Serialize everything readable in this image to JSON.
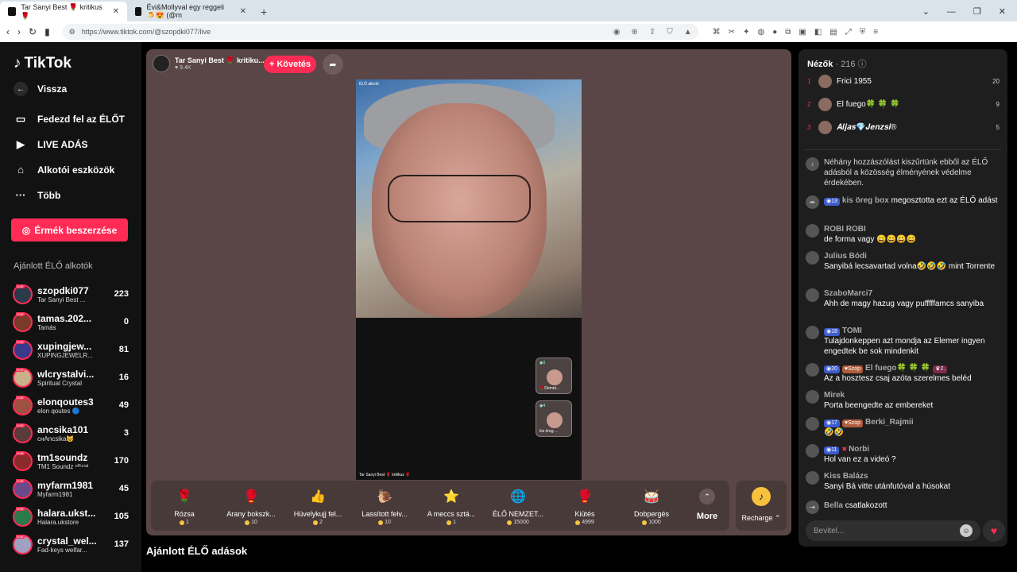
{
  "browser": {
    "tabs": [
      {
        "title": "Tar Sanyi Best 🌹 kritikus 🌹"
      },
      {
        "title": "Évi&Mollyval egy reggeli 🍮😍 (@m"
      }
    ],
    "url": "https://www.tiktok.com/@szopdki077/live"
  },
  "sidebar": {
    "logo": "TikTok",
    "back": "Vissza",
    "nav": [
      {
        "label": "Fedezd fel az ÉLŐT",
        "icon": "explore-live-icon"
      },
      {
        "label": "LIVE ADÁS",
        "icon": "camera-icon"
      },
      {
        "label": "Alkotói eszközök",
        "icon": "house-icon"
      },
      {
        "label": "Több",
        "icon": "more-dots-icon"
      }
    ],
    "coins_button": "Érmék beszerzése",
    "recommended_title": "Ajánlott ÉLŐ alkotók",
    "creators": [
      {
        "name": "szopdki077",
        "sub": "Tar Sanyi Best ...",
        "count": "223",
        "color": "#2b3a4a"
      },
      {
        "name": "tamas.202...",
        "sub": "Tamás",
        "count": "0",
        "color": "#7a3a2a"
      },
      {
        "name": "xupingjew...",
        "sub": "XUPINGJEWELR...",
        "count": "81",
        "color": "#3a3a8a"
      },
      {
        "name": "wlcrystalvi...",
        "sub": "Spiritual Crystal",
        "count": "16",
        "color": "#c9b089"
      },
      {
        "name": "elonqoutes3",
        "sub": "elon qoutes 🔵",
        "count": "49",
        "color": "#a05040"
      },
      {
        "name": "ancsika101",
        "sub": "ᴄнAncsika😺",
        "count": "3",
        "color": "#5a3a3a"
      },
      {
        "name": "tm1soundz",
        "sub": "TM1 Soundz ᵒᶠᶠⁱᶜⁱᵃˡ",
        "count": "170",
        "color": "#8a2a2a"
      },
      {
        "name": "myfarm1981",
        "sub": "Myfarm1981",
        "count": "45",
        "color": "#6a4a8a"
      },
      {
        "name": "halara.ukst...",
        "sub": "Halara.ukstore",
        "count": "105",
        "color": "#2a7a4a"
      },
      {
        "name": "crystal_wel...",
        "sub": "Fad-keys welfar...",
        "count": "137",
        "color": "#a0a0c0"
      }
    ]
  },
  "stream": {
    "host_name": "Tar Sanyi Best 🌹 kritiku...",
    "likes": "♥ 9.4K",
    "follow_button": "+ Követés",
    "video_top_text": "ÉLŐ alkotó",
    "video_bottom_text": "Tar Sanyi Best 🌹 kritikus 🌹",
    "cohosts": [
      {
        "count": "◉0",
        "label": "🌹Demet..."
      },
      {
        "count": "◉4",
        "label": "kis öreg ..."
      }
    ],
    "gifts": [
      {
        "name": "Rózsa",
        "price": "1",
        "icon": "🌹"
      },
      {
        "name": "Arany bokszk...",
        "price": "10",
        "icon": "🥊"
      },
      {
        "name": "Hüvelykujj fel...",
        "price": "2",
        "icon": "👍"
      },
      {
        "name": "Lassított felv...",
        "price": "10",
        "icon": "🐌"
      },
      {
        "name": "A meccs sztá...",
        "price": "1",
        "icon": "⭐"
      },
      {
        "name": "ÉLŐ NEMZET...",
        "price": "15000",
        "icon": "🌐"
      },
      {
        "name": "Kiütés",
        "price": "4999",
        "icon": "🥊"
      },
      {
        "name": "Dobpergés",
        "price": "1000",
        "icon": "🥁"
      }
    ],
    "more_label": "More",
    "recharge_label": "Recharge ⌃",
    "bottom_title": "Ajánlott ÉLŐ adások"
  },
  "chat": {
    "viewers_label": "Nézők",
    "viewers_count": "· 216",
    "top": [
      {
        "rank": "1",
        "name": "Frici 1955",
        "score": "20"
      },
      {
        "rank": "2",
        "name": "El fuego🍀 🍀 🍀",
        "score": "9"
      },
      {
        "rank": "3",
        "name": "𝑨𝒍𝒋𝒂𝒔💎𝑱𝒆𝒏𝒛𝒔𝒊®",
        "score": "5"
      }
    ],
    "messages": [
      {
        "user": "",
        "text": "Néhány hozzászólást kiszűrtünk ebből az ÉLŐ adásból a közösség élményének védelme érdekében.",
        "badges": []
      },
      {
        "user": "kis öreg box",
        "text": "megosztotta ezt az ÉLŐ adást",
        "badges": [
          "◉13"
        ]
      },
      {
        "user": "ROBI ROBI",
        "text": "de forma vagy 😄😄😄😄",
        "badges": []
      },
      {
        "user": "Julius Bódi",
        "text": "Sanyibá lecsavartad volna🤣🤣🤣 mint Torrente",
        "badges": []
      },
      {
        "user": "SzaboMarci7",
        "text": "Ahh de magy hazug vagy pufffffamcs sanyiba",
        "badges": []
      },
      {
        "user": "TOMI",
        "text": "Tulajdonkeppen azt mondja az Elemer ingyen engedtek be sok mindenkit",
        "badges": [
          "◉18"
        ]
      },
      {
        "user": "El fuego🍀 🍀 🍀",
        "text": "Az a hosztesz csaj azóta szerelmes beléd",
        "badges": [
          "◉20",
          "♥Szop",
          "♛2."
        ]
      },
      {
        "user": "Mirek",
        "text": "Porta beengedte az embereket",
        "badges": []
      },
      {
        "user": "Berki_Rajmii",
        "text": "🤣🤣",
        "badges": [
          "◉17",
          "♥Szop"
        ]
      },
      {
        "user": "Norbi",
        "text": "Hol van ez a videó ?",
        "badges": [
          "◉11",
          "✖"
        ]
      },
      {
        "user": "Kiss Balázs",
        "text": "Sanyi Bá vitte utánfutóval a húsokat",
        "badges": []
      },
      {
        "user": "Bella",
        "text": "csatlakozott",
        "badges": []
      }
    ],
    "input_placeholder": "Bevitel..."
  }
}
